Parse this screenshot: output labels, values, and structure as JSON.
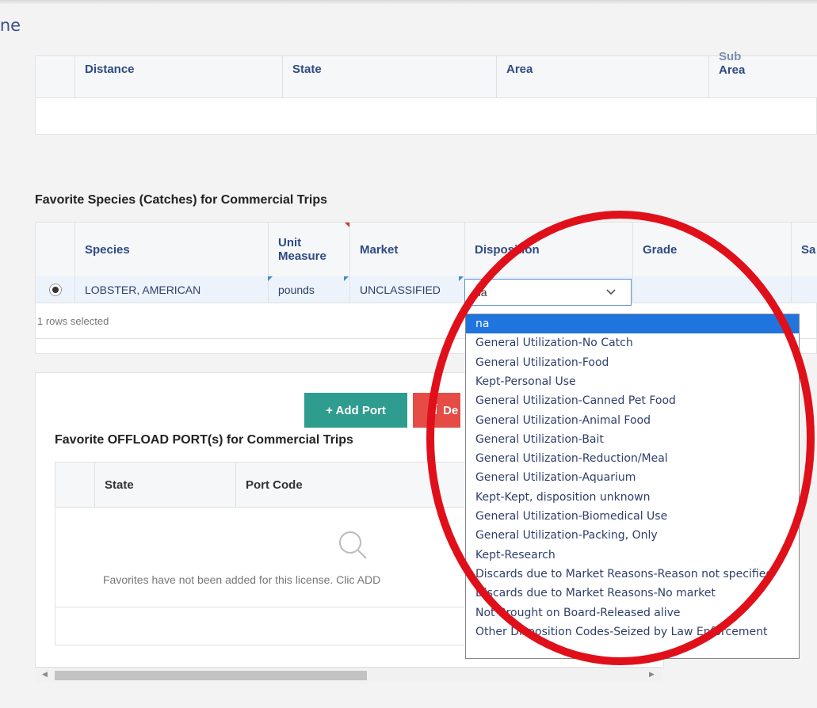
{
  "app": {
    "title": "ine"
  },
  "location_table": {
    "columns": [
      "Distance",
      "State",
      "Area",
      "Sub",
      "Area"
    ]
  },
  "species_section": {
    "title": "Favorite Species (Catches) for Commercial Trips",
    "columns": [
      "Species",
      "Unit",
      "Measure",
      "Market",
      "Disposition",
      "Grade",
      "Sa"
    ],
    "row": {
      "species": "LOBSTER, AMERICAN",
      "unit": "pounds",
      "market": "UNCLASSIFIED",
      "disposition": "na"
    },
    "footer": "1 rows selected"
  },
  "port_section": {
    "add_label": "+ Add Port",
    "delete_label": "De",
    "title": "Favorite OFFLOAD PORT(s) for Commercial Trips",
    "columns": [
      "State",
      "Port Code"
    ],
    "empty_message": "Favorites have not been added for this license. Clic ADD"
  },
  "disposition_options": [
    "na",
    "General Utilization-No Catch",
    "General Utilization-Food",
    "Kept-Personal Use",
    "General Utilization-Canned Pet Food",
    "General Utilization-Animal Food",
    "General Utilization-Bait",
    "General Utilization-Reduction/Meal",
    "General Utilization-Aquarium",
    "Kept-Kept, disposition unknown",
    "General Utilization-Biomedical Use",
    "General Utilization-Packing, Only",
    "Kept-Research",
    "Discards due to Market Reasons-Reason not specified",
    "Discards due to Market Reasons-No market",
    "Not Brought on Board-Released alive",
    "Other Disposition Codes-Seized by Law Enforcement"
  ],
  "colors": {
    "accent": "#1f74de",
    "add_button": "#2e9c8e",
    "delete_button": "#e44c45",
    "highlight": "#e0101a"
  },
  "icons": {
    "empty_state": "search-icon",
    "dropdown": "chevron-down-icon",
    "delete": "trash-icon"
  }
}
